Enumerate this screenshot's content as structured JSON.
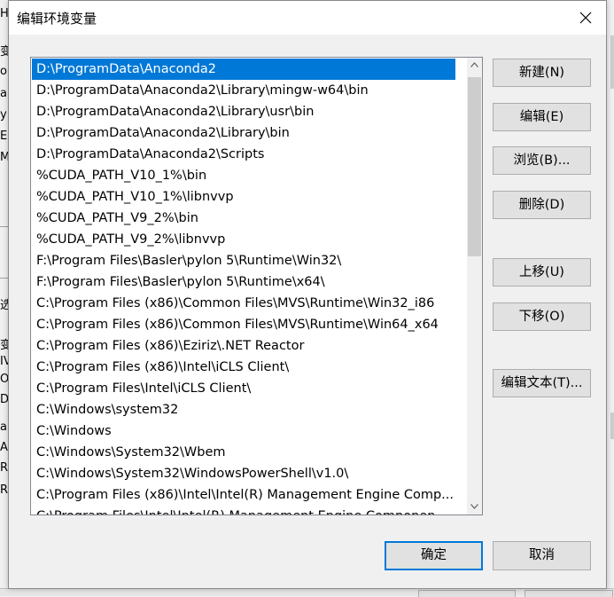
{
  "background_fragments": [
    "H",
    "变",
    "or",
    "a",
    "y",
    "E",
    "M",
    "选",
    "变",
    "IV",
    "OI",
    "DS",
    "a",
    "A",
    "R",
    "R"
  ],
  "dialog": {
    "title": "编辑环境变量",
    "close_icon": "close-icon"
  },
  "list": {
    "selected_index": 0,
    "items": [
      "D:\\ProgramData\\Anaconda2",
      "D:\\ProgramData\\Anaconda2\\Library\\mingw-w64\\bin",
      "D:\\ProgramData\\Anaconda2\\Library\\usr\\bin",
      "D:\\ProgramData\\Anaconda2\\Library\\bin",
      "D:\\ProgramData\\Anaconda2\\Scripts",
      "%CUDA_PATH_V10_1%\\bin",
      "%CUDA_PATH_V10_1%\\libnvvp",
      "%CUDA_PATH_V9_2%\\bin",
      "%CUDA_PATH_V9_2%\\libnvvp",
      "F:\\Program Files\\Basler\\pylon 5\\Runtime\\Win32\\",
      "F:\\Program Files\\Basler\\pylon 5\\Runtime\\x64\\",
      "C:\\Program Files (x86)\\Common Files\\MVS\\Runtime\\Win32_i86",
      "C:\\Program Files (x86)\\Common Files\\MVS\\Runtime\\Win64_x64",
      "C:\\Program Files (x86)\\Eziriz\\.NET Reactor",
      "C:\\Program Files (x86)\\Intel\\iCLS Client\\",
      "C:\\Program Files\\Intel\\iCLS Client\\",
      "C:\\Windows\\system32",
      "C:\\Windows",
      "C:\\Windows\\System32\\Wbem",
      "C:\\Windows\\System32\\WindowsPowerShell\\v1.0\\",
      "C:\\Program Files (x86)\\Intel\\Intel(R) Management Engine Comp...",
      "C:\\Program Files\\Intel\\Intel(R) Management Engine Componen..."
    ]
  },
  "buttons": {
    "new": "新建(N)",
    "edit": "编辑(E)",
    "browse": "浏览(B)...",
    "delete": "删除(D)",
    "move_up": "上移(U)",
    "move_down": "下移(O)",
    "edit_text": "编辑文本(T)...",
    "ok": "确定",
    "cancel": "取消"
  }
}
